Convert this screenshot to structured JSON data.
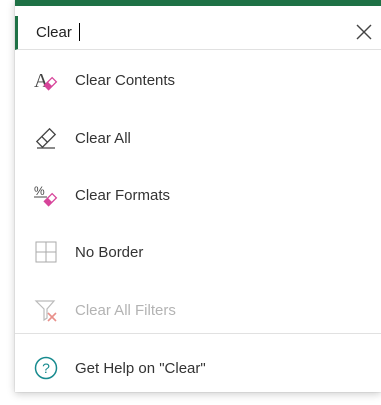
{
  "search": {
    "value": "Clear"
  },
  "menu": {
    "items": [
      {
        "label": "Clear Contents"
      },
      {
        "label": "Clear All"
      },
      {
        "label": "Clear Formats"
      },
      {
        "label": "No Border"
      },
      {
        "label": "Clear All Filters",
        "disabled": true
      }
    ],
    "help_label": "Get Help on \"Clear\""
  },
  "colors": {
    "accent": "#1E7145",
    "pink": "#D7449A",
    "help_teal": "#168A8E",
    "text": "#333333",
    "disabled_text": "#B3B3B3"
  }
}
